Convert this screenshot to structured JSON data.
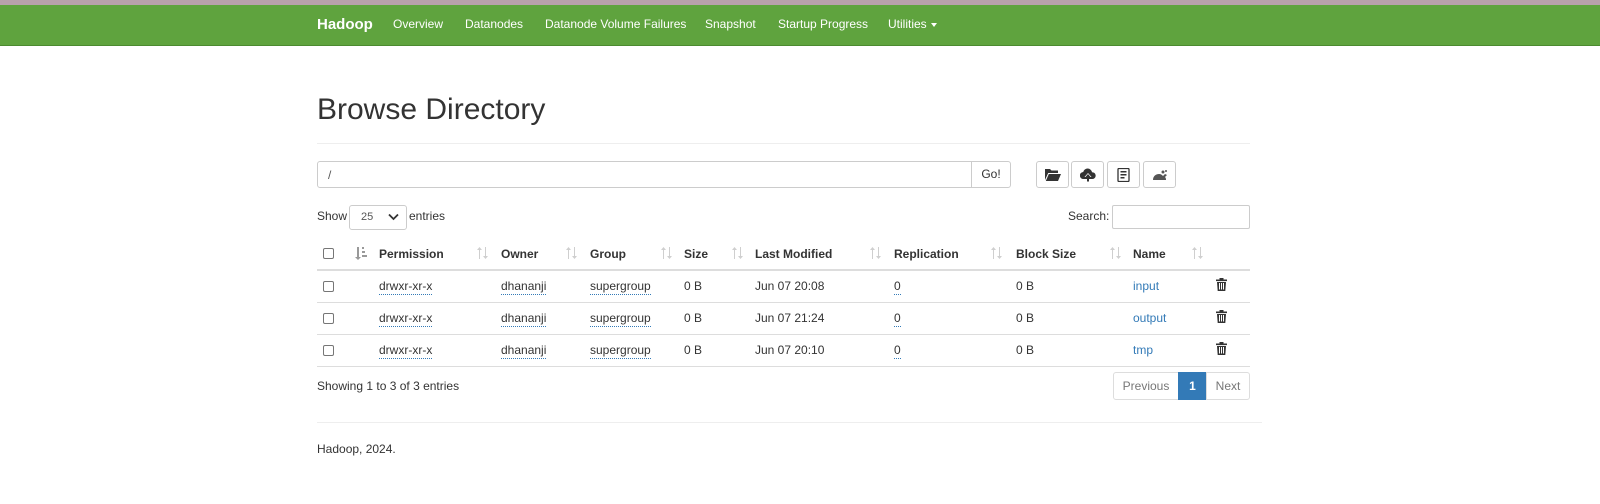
{
  "navbar": {
    "brand": "Hadoop",
    "items": [
      "Overview",
      "Datanodes",
      "Datanode Volume Failures",
      "Snapshot",
      "Startup Progress",
      "Utilities"
    ]
  },
  "page": {
    "title": "Browse Directory"
  },
  "path_bar": {
    "value": "/",
    "go_label": "Go!"
  },
  "toolbar": {
    "icons": [
      "folder-open-icon",
      "upload-cloud-icon",
      "book-icon",
      "cut-paste-icon"
    ]
  },
  "table_controls": {
    "show_label": "Show",
    "page_length": "25",
    "entries_label": "entries",
    "search_label": "Search:",
    "search_value": ""
  },
  "table": {
    "headers": {
      "permission": "Permission",
      "owner": "Owner",
      "group": "Group",
      "size": "Size",
      "last_modified": "Last Modified",
      "replication": "Replication",
      "block_size": "Block Size",
      "name": "Name"
    },
    "rows": [
      {
        "permission": "drwxr-xr-x",
        "owner": "dhananji",
        "group": "supergroup",
        "size": "0 B",
        "last_modified": "Jun 07 20:08",
        "replication": "0",
        "block_size": "0 B",
        "name": "input"
      },
      {
        "permission": "drwxr-xr-x",
        "owner": "dhananji",
        "group": "supergroup",
        "size": "0 B",
        "last_modified": "Jun 07 21:24",
        "replication": "0",
        "block_size": "0 B",
        "name": "output"
      },
      {
        "permission": "drwxr-xr-x",
        "owner": "dhananji",
        "group": "supergroup",
        "size": "0 B",
        "last_modified": "Jun 07 20:10",
        "replication": "0",
        "block_size": "0 B",
        "name": "tmp"
      }
    ]
  },
  "table_info": "Showing 1 to 3 of 3 entries",
  "pagination": {
    "previous": "Previous",
    "current_page": "1",
    "next": "Next"
  },
  "footer": {
    "text": "Hadoop, 2024."
  },
  "colors": {
    "navbar_bg": "#5fa33e",
    "link": "#337ab7",
    "active_page": "#337ab7"
  }
}
